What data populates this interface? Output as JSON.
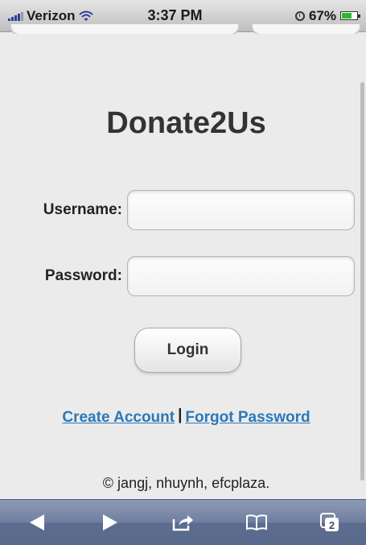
{
  "status_bar": {
    "carrier": "Verizon",
    "time": "3:37 PM",
    "battery": "67%",
    "battery_level": 0.67
  },
  "page": {
    "title": "Donate2Us",
    "username_label": "Username:",
    "username_value": "",
    "password_label": "Password:",
    "password_value": "",
    "login_label": "Login",
    "create_account_label": "Create Account",
    "separator": "|",
    "forgot_password_label": "Forgot Password",
    "footer": "© jangj, nhuynh, efcplaza."
  },
  "toolbar": {
    "tab_count": "2",
    "icons": [
      "back-icon",
      "forward-icon",
      "share-icon",
      "bookmarks-icon",
      "tabs-icon"
    ]
  },
  "colors": {
    "link": "#2c77b8",
    "toolbar": "#6f7f9f",
    "battery": "#2db82d"
  }
}
